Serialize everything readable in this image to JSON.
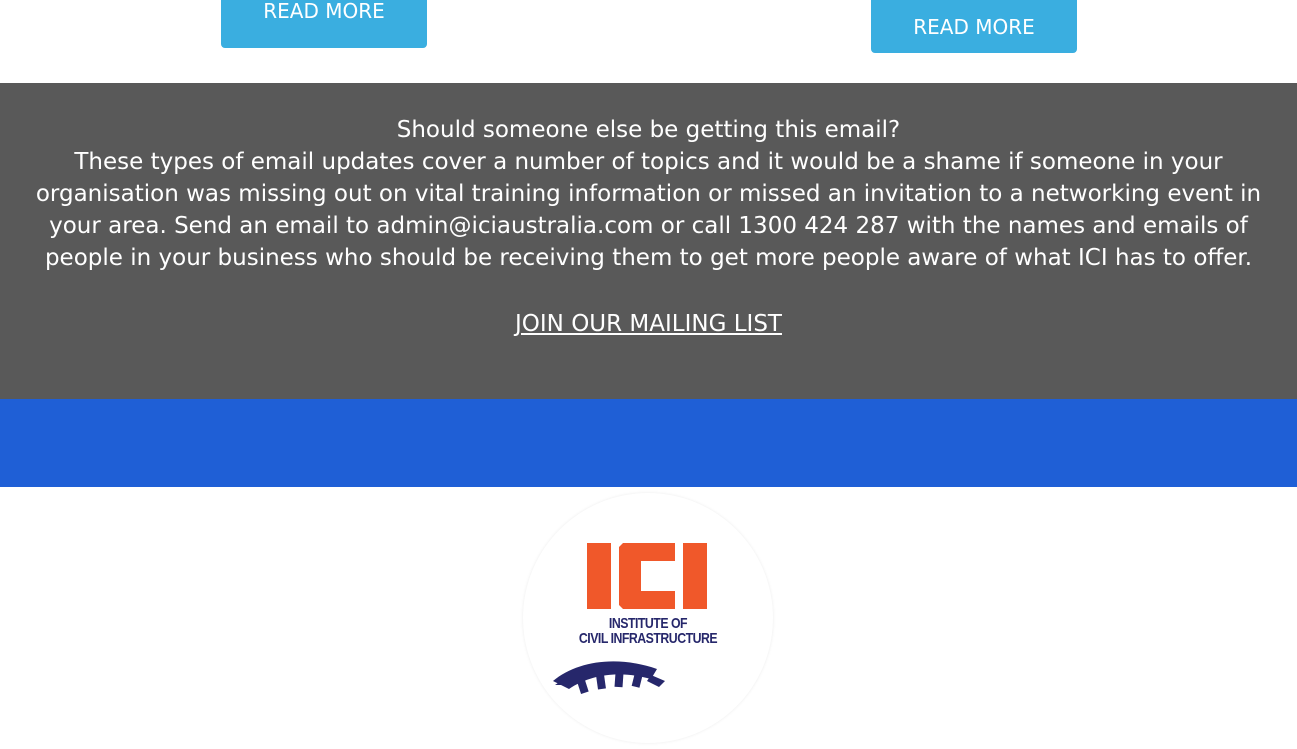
{
  "buttons": {
    "left_label": "READ MORE",
    "right_label": "READ MORE"
  },
  "notice": {
    "heading": "Should someone else be getting this email?",
    "body": "These types of email updates cover a number of topics and it would be a shame if someone in your organisation was missing out on vital training information or missed an invitation to a networking event in your area. Send an email to admin@iciaustralia.com or call 1300 424 287 with the names and emails of people in your business who should be receiving them to get more people aware of what ICI has to offer.",
    "join_link": "JOIN OUR MAILING LIST"
  },
  "logo": {
    "letters": "ICI",
    "line1": "INSTITUTE OF",
    "line2": "CIVIL INFRASTRUCTURE",
    "icon": "gear-icon"
  },
  "colors": {
    "button": "#3aaee0",
    "grey_band": "#595959",
    "blue_band": "#1f5fd6",
    "logo_orange": "#f0582a",
    "logo_navy": "#26276b"
  }
}
